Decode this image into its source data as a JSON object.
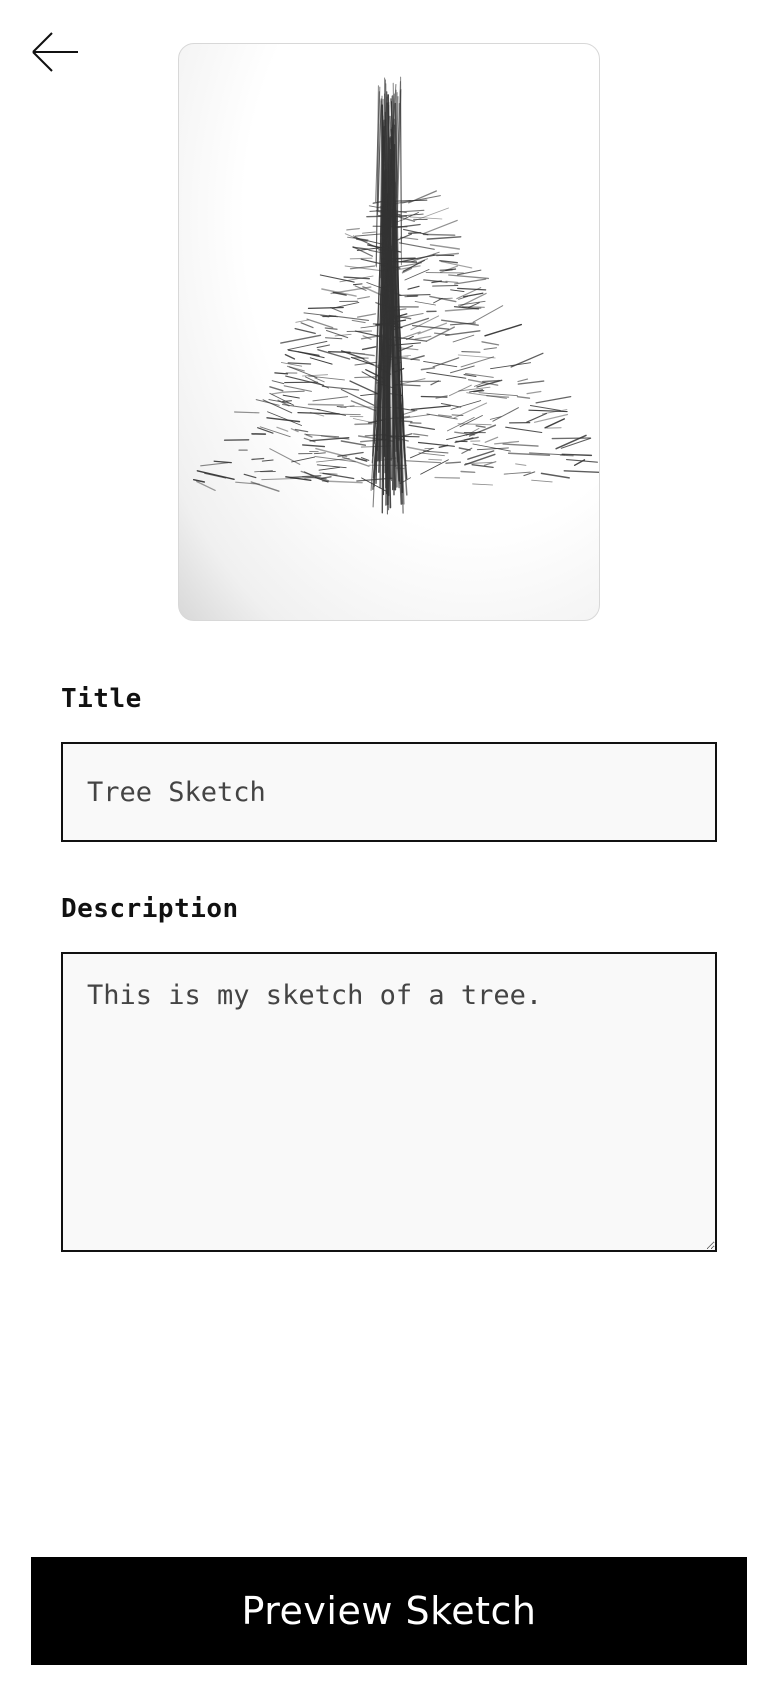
{
  "header": {
    "back_icon": "arrow-left-icon"
  },
  "sketch": {
    "image_icon": "tree-sketch-image"
  },
  "form": {
    "title_label": "Title",
    "title_value": "Tree Sketch",
    "description_label": "Description",
    "description_value": "This is my sketch of a tree."
  },
  "actions": {
    "preview_label": "Preview Sketch"
  }
}
